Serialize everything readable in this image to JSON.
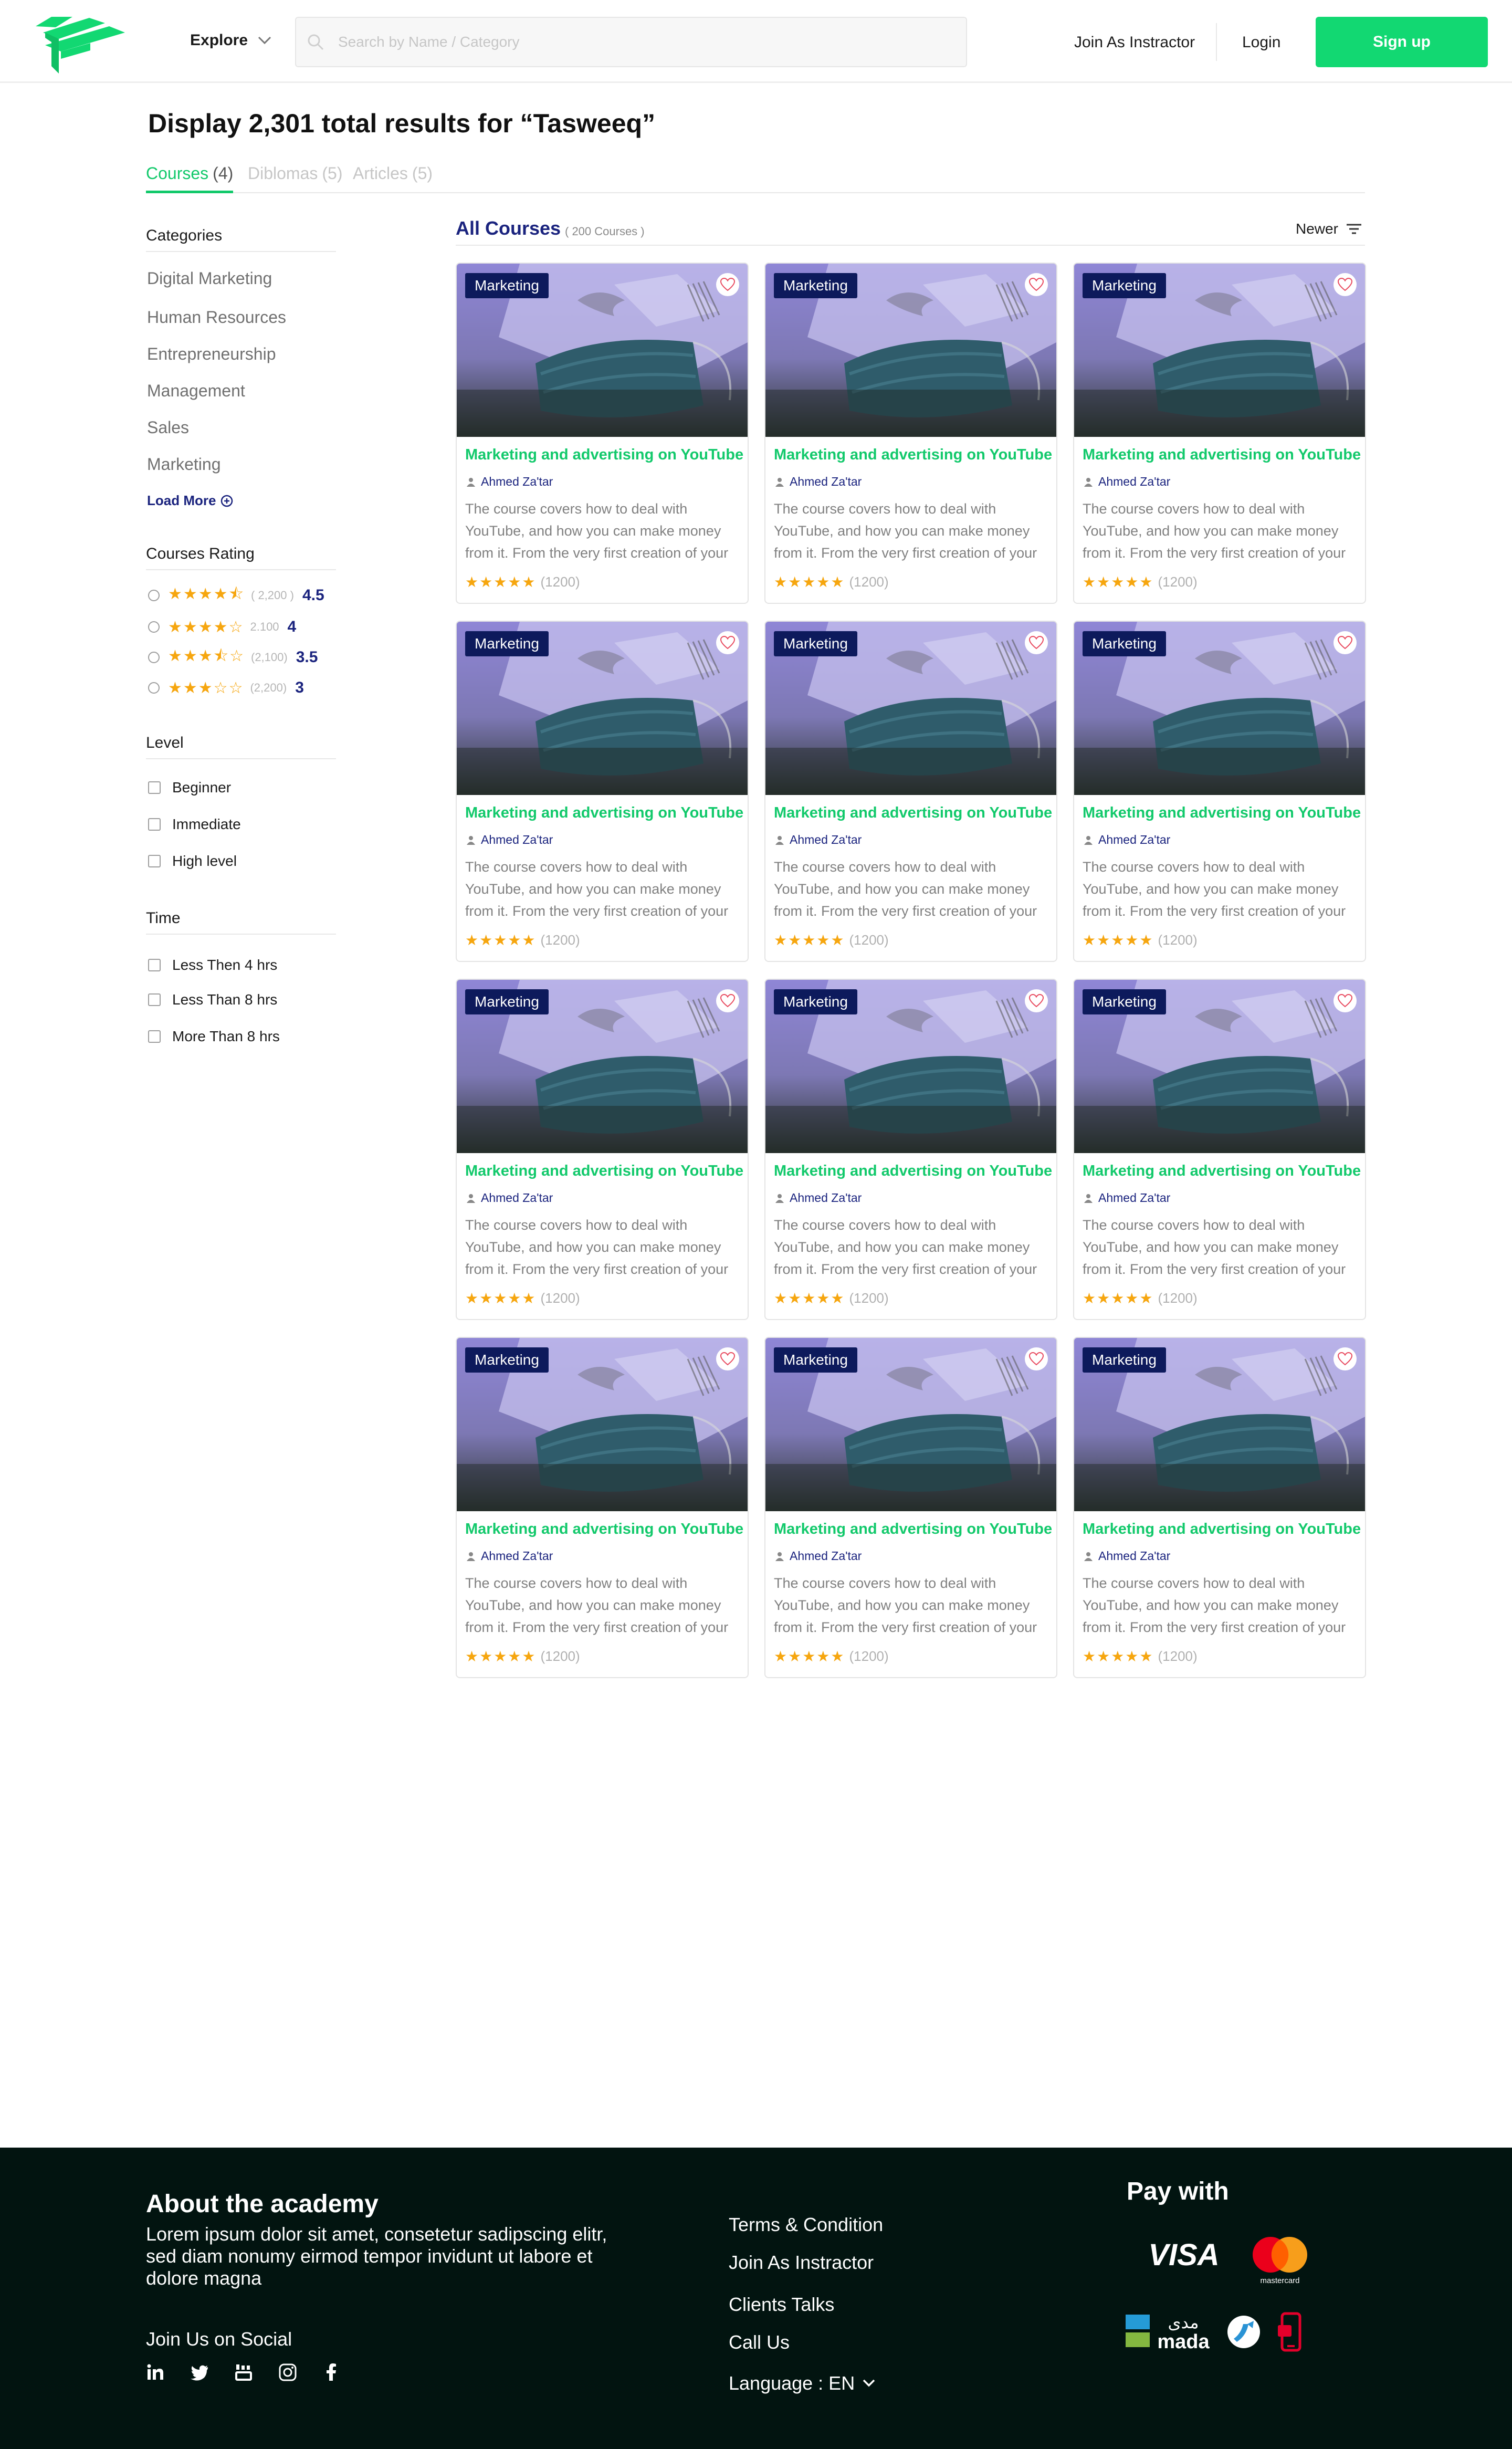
{
  "header": {
    "explore_label": "Explore",
    "search_placeholder": "Search by Name / Category",
    "join_label": "Join As Instractor",
    "login_label": "Login",
    "signup_label": "Sign up"
  },
  "page": {
    "title": "Display 2,301 total results for “Tasweeq”"
  },
  "tabs": [
    {
      "label": "Courses",
      "count": "(4)",
      "active": true
    },
    {
      "label": "Diblomas",
      "count": "(5)",
      "active": false
    },
    {
      "label": "Articles",
      "count": "(5)",
      "active": false
    }
  ],
  "sidebar": {
    "categories_title": "Categories",
    "categories": [
      "Digital Marketing",
      "Human Resources",
      "Entrepreneurship",
      "Management",
      "Sales",
      "Marketing"
    ],
    "load_more": "Load More",
    "rating_title": "Courses Rating",
    "ratings": [
      {
        "stars": "★★★★⯪",
        "count": "( 2,200 )",
        "value": "4.5"
      },
      {
        "stars": "★★★★☆",
        "count": "2.100",
        "value": "4"
      },
      {
        "stars": "★★★⯪☆",
        "count": "(2,100)",
        "value": "3.5"
      },
      {
        "stars": "★★★☆☆",
        "count": "(2,200)",
        "value": "3"
      }
    ],
    "level_title": "Level",
    "levels": [
      "Beginner",
      "Immediate",
      "High level"
    ],
    "time_title": "Time",
    "times": [
      "Less Then 4 hrs",
      "Less Than 8 hrs",
      "More Than 8 hrs"
    ]
  },
  "courses": {
    "heading": "All Courses",
    "count": "( 200 Courses )",
    "sort_label": "Newer",
    "items": [
      {
        "category": "Marketing",
        "title": "Marketing and advertising on YouTube",
        "author": "Ahmed Za'tar",
        "description": "The course covers how to deal with YouTube, and how you can make money from it. From the very first creation of your channel",
        "stars": "★★★★★",
        "rating_count": "(1200)"
      },
      {
        "category": "Marketing",
        "title": "Marketing and advertising on YouTube",
        "author": "Ahmed Za'tar",
        "description": "The course covers how to deal with YouTube, and how you can make money from it. From the very first creation of your channel",
        "stars": "★★★★★",
        "rating_count": "(1200)"
      },
      {
        "category": "Marketing",
        "title": "Marketing and advertising on YouTube",
        "author": "Ahmed Za'tar",
        "description": "The course covers how to deal with YouTube, and how you can make money from it. From the very first creation of your channel",
        "stars": "★★★★★",
        "rating_count": "(1200)"
      },
      {
        "category": "Marketing",
        "title": "Marketing and advertising on YouTube",
        "author": "Ahmed Za'tar",
        "description": "The course covers how to deal with YouTube, and how you can make money from it. From the very first creation of your channel",
        "stars": "★★★★★",
        "rating_count": "(1200)"
      },
      {
        "category": "Marketing",
        "title": "Marketing and advertising on YouTube",
        "author": "Ahmed Za'tar",
        "description": "The course covers how to deal with YouTube, and how you can make money from it. From the very first creation of your channel",
        "stars": "★★★★★",
        "rating_count": "(1200)"
      },
      {
        "category": "Marketing",
        "title": "Marketing and advertising on YouTube",
        "author": "Ahmed Za'tar",
        "description": "The course covers how to deal with YouTube, and how you can make money from it. From the very first creation of your channel",
        "stars": "★★★★★",
        "rating_count": "(1200)"
      },
      {
        "category": "Marketing",
        "title": "Marketing and advertising on YouTube",
        "author": "Ahmed Za'tar",
        "description": "The course covers how to deal with YouTube, and how you can make money from it. From the very first creation of your channel",
        "stars": "★★★★★",
        "rating_count": "(1200)"
      },
      {
        "category": "Marketing",
        "title": "Marketing and advertising on YouTube",
        "author": "Ahmed Za'tar",
        "description": "The course covers how to deal with YouTube, and how you can make money from it. From the very first creation of your channel",
        "stars": "★★★★★",
        "rating_count": "(1200)"
      },
      {
        "category": "Marketing",
        "title": "Marketing and advertising on YouTube",
        "author": "Ahmed Za'tar",
        "description": "The course covers how to deal with YouTube, and how you can make money from it. From the very first creation of your channel",
        "stars": "★★★★★",
        "rating_count": "(1200)"
      },
      {
        "category": "Marketing",
        "title": "Marketing and advertising on YouTube",
        "author": "Ahmed Za'tar",
        "description": "The course covers how to deal with YouTube, and how you can make money from it. From the very first creation of your channel",
        "stars": "★★★★★",
        "rating_count": "(1200)"
      },
      {
        "category": "Marketing",
        "title": "Marketing and advertising on YouTube",
        "author": "Ahmed Za'tar",
        "description": "The course covers how to deal with YouTube, and how you can make money from it. From the very first creation of your channel",
        "stars": "★★★★★",
        "rating_count": "(1200)"
      },
      {
        "category": "Marketing",
        "title": "Marketing and advertising on YouTube",
        "author": "Ahmed Za'tar",
        "description": "The course covers how to deal with YouTube, and how you can make money from it. From the very first creation of your channel",
        "stars": "★★★★★",
        "rating_count": "(1200)"
      }
    ]
  },
  "footer": {
    "about_title": "About the academy",
    "about_text": "Lorem ipsum dolor sit amet, consetetur sadipscing elitr, sed diam nonumy eirmod tempor invidunt ut labore et dolore magna",
    "social_title": "Join Us on Social",
    "social_icons": [
      "linkedin-icon",
      "twitter-icon",
      "youtube-icon",
      "instagram-icon",
      "facebook-icon"
    ],
    "links": [
      "Terms & Condition",
      "Join As Instractor",
      "Clients Talks",
      "Call Us"
    ],
    "language_label": "Language : EN",
    "pay_title": "Pay with",
    "visa_label": "VISA",
    "mastercard_label": "mastercard",
    "mada_label": "mada",
    "mada_arabic": "مدى"
  },
  "colors": {
    "brand_green": "#12d872",
    "navy": "#1a237e",
    "star": "#f6a60f",
    "footer_bg": "#021410"
  }
}
